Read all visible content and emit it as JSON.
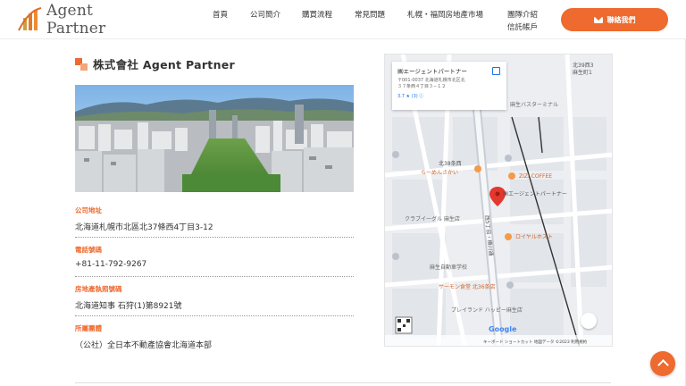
{
  "header": {
    "logo_text": "Agent Partner",
    "nav": [
      {
        "label": "首頁"
      },
      {
        "label": "公司簡介"
      },
      {
        "label": "購買流程"
      },
      {
        "label": "常見問題"
      },
      {
        "label": "札幌・福岡房地產市場"
      },
      {
        "label": "團隊介紹"
      },
      {
        "label": "信託帳戶"
      }
    ],
    "contact_label": "聯絡我們"
  },
  "company": {
    "title": "株式會社 Agent Partner",
    "rows": [
      {
        "label": "公司地址",
        "value": "北海道札幌市北區北37條西4丁目3-12"
      },
      {
        "label": "電話號碼",
        "value": "+81-11-792-9267"
      },
      {
        "label": "房地產執照號碼",
        "value": "北海道知事 石狩(1)第8921號"
      },
      {
        "label": "所屬團體",
        "value": "（公社）全日本不動產協會北海道本部"
      }
    ]
  },
  "map": {
    "card_title": "㈱エージェントパートナー",
    "card_address_line1": "〒001-0037 北海道札幌市北区北",
    "card_address_line2": "３７条西４丁目３−１２",
    "card_rating": "3.7 ★ (3) ⓘ",
    "labels": {
      "pin": "㈱エージェントパートナー",
      "street": "西5丁目・樽川通",
      "station": "北39西3",
      "station2": "麻生町1",
      "terminal": "麻生バスターミナル",
      "cafe": "ZIZI COFFEE",
      "ramen_area": "北38条西",
      "ramen": "らーめんさかい",
      "club": "クラブイーグル 麻生店",
      "lawson": "ロイヤルホスト",
      "school": "麻生自動車学校",
      "salmon": "サーモン食堂 北36条店",
      "pachinko": "プレイランド ハッピー麻生店",
      "google": "Google",
      "footer": "キーボード ショートカット  地図データ ©2023  利用規約"
    }
  }
}
